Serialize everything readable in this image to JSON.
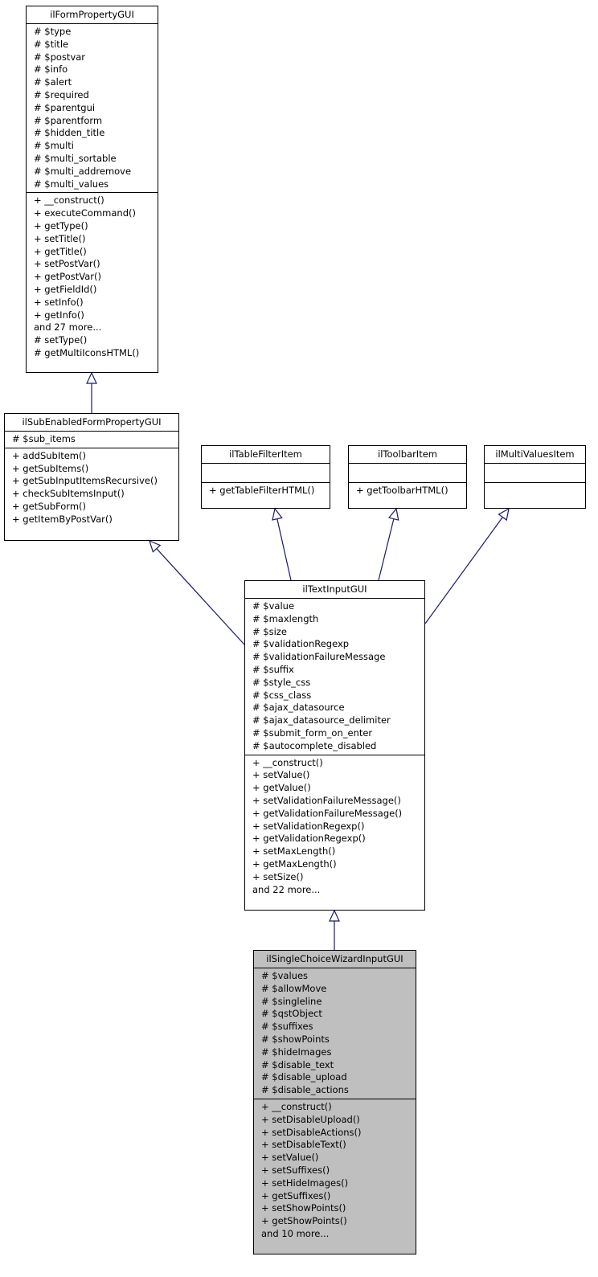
{
  "diagram": {
    "edge_color": "#191970",
    "highlight_fill": "#bfbfbf",
    "classes": [
      {
        "id": "ilFormPropertyGUI",
        "name": "ilFormPropertyGUI",
        "attributes": [
          "# $type",
          "# $title",
          "# $postvar",
          "# $info",
          "# $alert",
          "# $required",
          "# $parentgui",
          "# $parentform",
          "# $hidden_title",
          "# $multi",
          "# $multi_sortable",
          "# $multi_addremove",
          "# $multi_values"
        ],
        "methods": [
          "+ __construct()",
          "+ executeCommand()",
          "+ getType()",
          "+ setTitle()",
          "+ getTitle()",
          "+ setPostVar()",
          "+ getPostVar()",
          "+ getFieldId()",
          "+ setInfo()",
          "+ getInfo()",
          "and 27 more...",
          "# setType()",
          "# getMultiIconsHTML()"
        ]
      },
      {
        "id": "ilSubEnabledFormPropertyGUI",
        "name": "ilSubEnabledFormPropertyGUI",
        "attributes": [
          "# $sub_items"
        ],
        "methods": [
          "+ addSubItem()",
          "+ getSubItems()",
          "+ getSubInputItemsRecursive()",
          "+ checkSubItemsInput()",
          "+ getSubForm()",
          "+ getItemByPostVar()"
        ]
      },
      {
        "id": "ilTableFilterItem",
        "name": "ilTableFilterItem",
        "attributes": [],
        "methods": [
          "+ getTableFilterHTML()"
        ]
      },
      {
        "id": "ilToolbarItem",
        "name": "ilToolbarItem",
        "attributes": [],
        "methods": [
          "+ getToolbarHTML()"
        ]
      },
      {
        "id": "ilMultiValuesItem",
        "name": "ilMultiValuesItem",
        "attributes": [],
        "methods": []
      },
      {
        "id": "ilTextInputGUI",
        "name": "ilTextInputGUI",
        "attributes": [
          "# $value",
          "# $maxlength",
          "# $size",
          "# $validationRegexp",
          "# $validationFailureMessage",
          "# $suffix",
          "# $style_css",
          "# $css_class",
          "# $ajax_datasource",
          "# $ajax_datasource_delimiter",
          "# $submit_form_on_enter",
          "# $autocomplete_disabled"
        ],
        "methods": [
          "+ __construct()",
          "+ setValue()",
          "+ getValue()",
          "+ setValidationFailureMessage()",
          "+ getValidationFailureMessage()",
          "+ setValidationRegexp()",
          "+ getValidationRegexp()",
          "+ setMaxLength()",
          "+ getMaxLength()",
          "+ setSize()",
          "and 22 more..."
        ]
      },
      {
        "id": "ilSingleChoiceWizardInputGUI",
        "name": "ilSingleChoiceWizardInputGUI",
        "highlighted": true,
        "attributes": [
          "# $values",
          "# $allowMove",
          "# $singleline",
          "# $qstObject",
          "# $suffixes",
          "# $showPoints",
          "# $hideImages",
          "# $disable_text",
          "# $disable_upload",
          "# $disable_actions"
        ],
        "methods": [
          "+ __construct()",
          "+ setDisableUpload()",
          "+ setDisableActions()",
          "+ setDisableText()",
          "+ setValue()",
          "+ setSuffixes()",
          "+ setHideImages()",
          "+ getSuffixes()",
          "+ setShowPoints()",
          "+ getShowPoints()",
          "and 10 more..."
        ]
      }
    ],
    "inheritance": [
      {
        "child": "ilSubEnabledFormPropertyGUI",
        "parent": "ilFormPropertyGUI"
      },
      {
        "child": "ilTextInputGUI",
        "parent": "ilSubEnabledFormPropertyGUI"
      },
      {
        "child": "ilTextInputGUI",
        "parent": "ilTableFilterItem"
      },
      {
        "child": "ilTextInputGUI",
        "parent": "ilToolbarItem"
      },
      {
        "child": "ilTextInputGUI",
        "parent": "ilMultiValuesItem"
      },
      {
        "child": "ilSingleChoiceWizardInputGUI",
        "parent": "ilTextInputGUI"
      }
    ]
  }
}
